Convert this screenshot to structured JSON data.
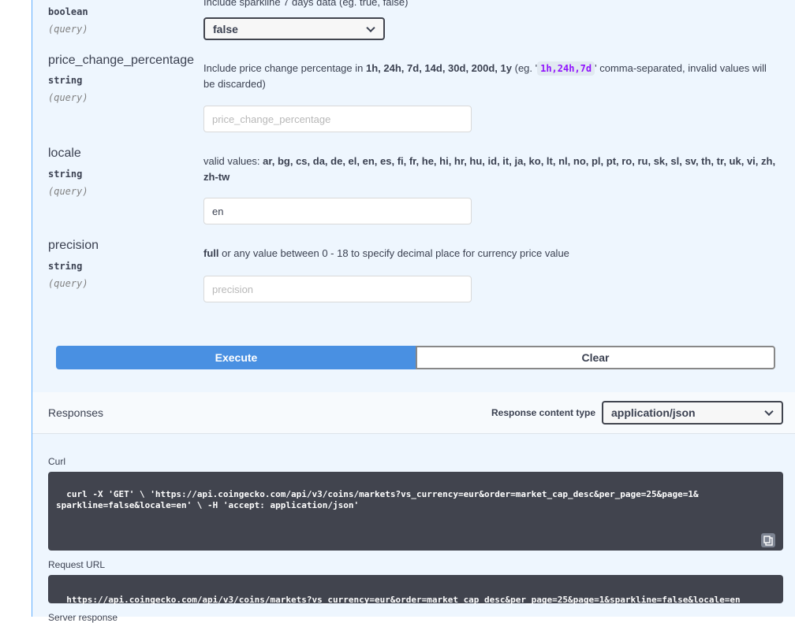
{
  "sparkline_param": {
    "desc_top": "Include sparkline 7 days data (eg. true, false)",
    "type": "boolean",
    "in": "(query)",
    "selected": "false"
  },
  "price_change_param": {
    "name": "price_change_percentage",
    "type": "string",
    "in": "(query)",
    "desc_prefix": "Include price change percentage in",
    "desc_bold": "1h, 24h, 7d, 14d, 30d, 200d, 1y",
    "desc_eg": "(eg. '",
    "desc_code": "1h,24h,7d",
    "desc_suffix": "' comma-separated, invalid values will be discarded)",
    "placeholder": "price_change_percentage",
    "value": ""
  },
  "locale_param": {
    "name": "locale",
    "type": "string",
    "in": "(query)",
    "desc_prefix": "valid values:",
    "desc_bold": "ar, bg, cs, da, de, el, en, es, fi, fr, he, hi, hr, hu, id, it, ja, ko, lt, nl, no, pl, pt, ro, ru, sk, sl, sv, th, tr, uk, vi, zh, zh-tw",
    "value": "en"
  },
  "precision_param": {
    "name": "precision",
    "type": "string",
    "in": "(query)",
    "desc_bold": "full",
    "desc_suffix": "or any value between 0 - 18 to specify decimal place for currency price value",
    "placeholder": "precision",
    "value": ""
  },
  "buttons": {
    "execute": "Execute",
    "clear": "Clear"
  },
  "responses": {
    "title": "Responses",
    "content_type_label": "Response content type",
    "content_type_value": "application/json"
  },
  "curl": {
    "label": "Curl",
    "command": "curl -X 'GET' \\ 'https://api.coingecko.com/api/v3/coins/markets?vs_currency=eur&order=market_cap_desc&per_page=25&page=1&\nsparkline=false&locale=en' \\ -H 'accept: application/json'"
  },
  "request_url": {
    "label": "Request URL",
    "value": "https://api.coingecko.com/api/v3/coins/markets?vs_currency=eur&order=market_cap_desc&per_page=25&page=1&sparkline=false&locale=en"
  },
  "server_response": {
    "label": "Server response"
  },
  "colors": {
    "execute_bg": "#4990e2",
    "code_bg": "#41444e",
    "inline_code": "#9012fe",
    "panel_bg": "#eef6fe"
  },
  "icons": {
    "copy": "clipboard-copy-icon",
    "select": "chevron-down-icon"
  }
}
